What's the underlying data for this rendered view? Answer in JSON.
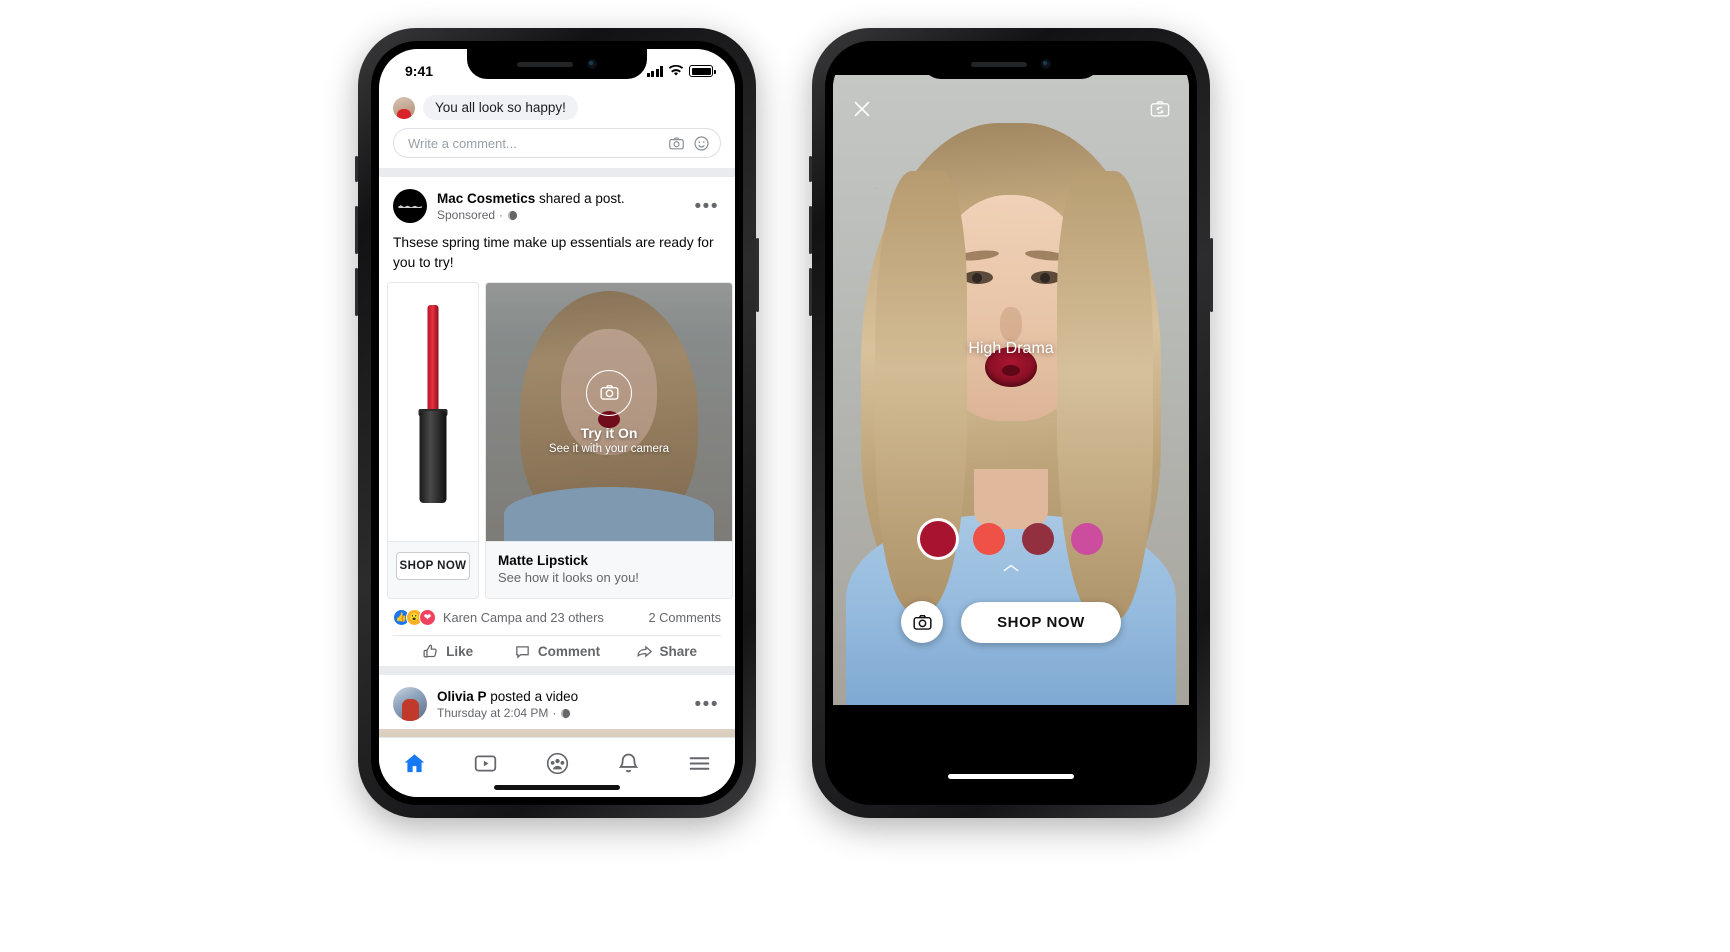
{
  "left_phone": {
    "status": {
      "time": "9:41",
      "signal_icon": "cellular-bars-icon",
      "wifi_icon": "wifi-icon",
      "battery_icon": "battery-icon"
    },
    "top_comment": {
      "text": "You all look so happy!",
      "avatar_icon": "commenter-avatar"
    },
    "composer": {
      "placeholder": "Write a comment...",
      "camera_icon": "camera-icon",
      "emoji_icon": "emoji-icon"
    },
    "sponsored_post": {
      "page_name": "Mac Cosmetics",
      "action_text": " shared a post.",
      "sponsored_label": "Sponsored",
      "separator": "·",
      "privacy_icon": "globe-icon",
      "menu_icon": "more-options-icon",
      "body": "Thsese spring time make up essentials are ready for you to try!",
      "card_product": {
        "shop_label": "SHOP NOW",
        "image_icon": "lipstick-product-image"
      },
      "card_ar": {
        "overlay_title": "Try it On",
        "overlay_subtitle": "See it with your camera",
        "overlay_icon": "camera-icon",
        "title": "Matte Lipstick",
        "subtitle": "See how it looks on you!"
      },
      "reactions": {
        "icons": [
          "like-reaction-icon",
          "wow-reaction-icon",
          "love-reaction-icon"
        ],
        "summary": "Karen Campa and 23 others",
        "comments": "2 Comments"
      },
      "actions": [
        {
          "label": "Like",
          "icon": "thumbs-up-icon"
        },
        {
          "label": "Comment",
          "icon": "comment-bubble-icon"
        },
        {
          "label": "Share",
          "icon": "share-arrow-icon"
        }
      ]
    },
    "next_post": {
      "user_name": "Olivia P",
      "action_text": " posted a video",
      "timestamp": "Thursday at 2:04 PM",
      "separator": "·",
      "privacy_icon": "globe-icon",
      "menu_icon": "more-options-icon"
    },
    "nav": [
      {
        "name": "home",
        "icon": "home-icon",
        "active": true
      },
      {
        "name": "watch",
        "icon": "video-play-icon",
        "active": false
      },
      {
        "name": "groups",
        "icon": "groups-icon",
        "active": false
      },
      {
        "name": "notifications",
        "icon": "bell-icon",
        "active": false
      },
      {
        "name": "menu",
        "icon": "hamburger-menu-icon",
        "active": false
      }
    ],
    "accent_color": "#1877f2"
  },
  "right_phone": {
    "close_icon": "close-x-icon",
    "flip_camera_icon": "flip-camera-icon",
    "shade_label": "High Drama",
    "swatches": [
      {
        "name": "high-drama",
        "color": "#a81330",
        "selected": true
      },
      {
        "name": "coral-red",
        "color": "#ef5146",
        "selected": false
      },
      {
        "name": "deep-berry",
        "color": "#92303f",
        "selected": false
      },
      {
        "name": "pink-orchid",
        "color": "#cc4d9e",
        "selected": false
      }
    ],
    "expand_icon": "chevron-up-icon",
    "camera_button_icon": "camera-icon",
    "shop_label": "SHOP NOW"
  }
}
